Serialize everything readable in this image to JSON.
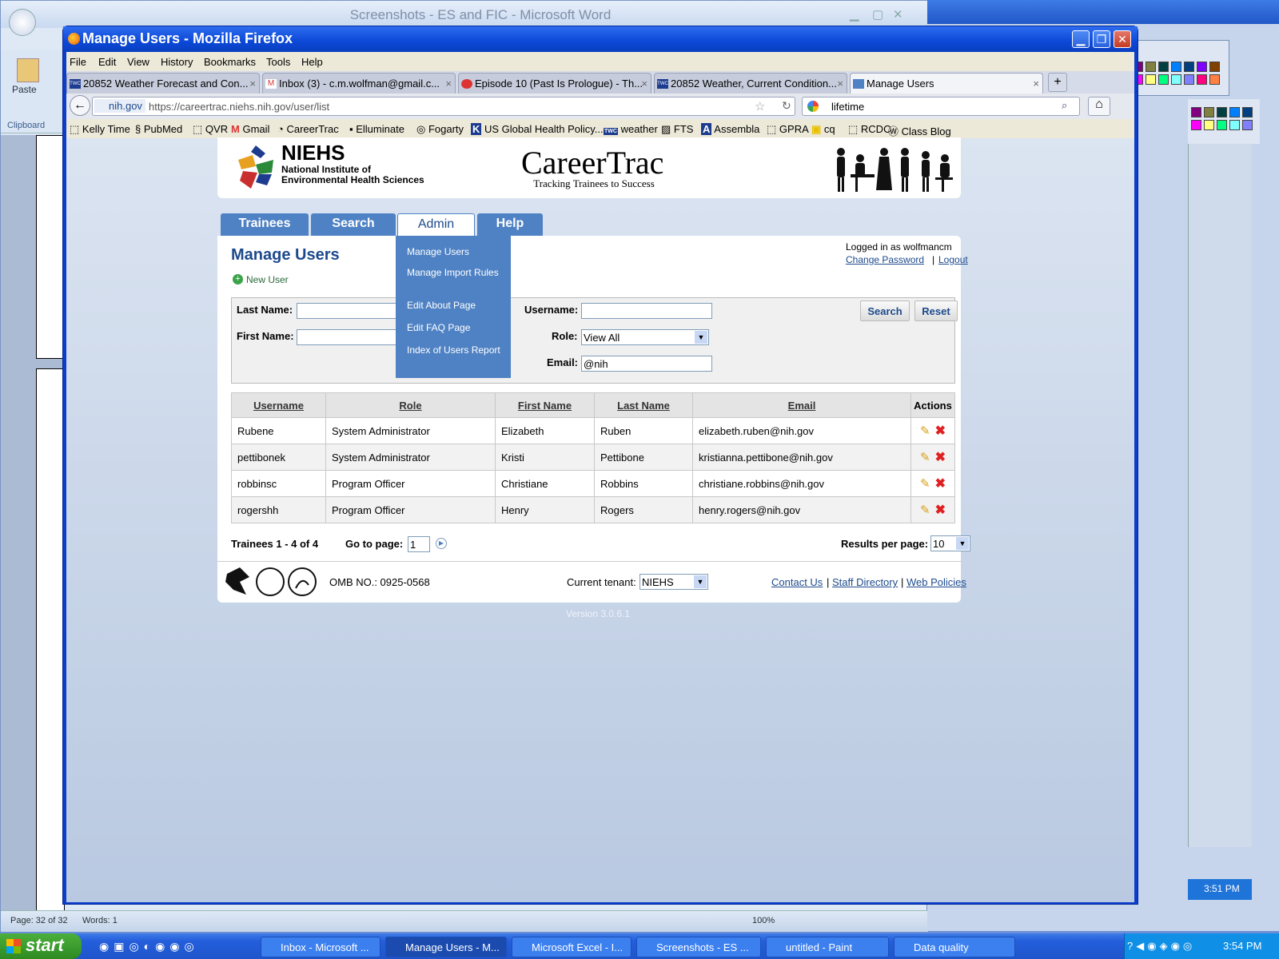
{
  "word": {
    "title": "Screenshots - ES and FIC - Microsoft Word",
    "paste_label": "Paste",
    "clipboard_label": "Clipboard",
    "status_page": "Page: 32 of 32",
    "status_words": "Words: 1",
    "zoom": "100%"
  },
  "firefox": {
    "title": "Manage Users - Mozilla Firefox",
    "menu": [
      "File",
      "Edit",
      "View",
      "History",
      "Bookmarks",
      "Tools",
      "Help"
    ],
    "tabs": [
      "20852 Weather Forecast and Con...",
      "Inbox (3) - c.m.wolfman@gmail.c...",
      "Episode 10 (Past Is Prologue) - Th...",
      "20852 Weather, Current Condition...",
      "Manage Users"
    ],
    "site_id": "nih.gov",
    "url": "https://careertrac.niehs.nih.gov/user/list",
    "search_value": "lifetime",
    "bookmarks": [
      "Kelly Time",
      "PubMed",
      "QVR",
      "Gmail",
      "CareerTrac",
      "Elluminate",
      "Fogarty",
      "US Global Health Policy...",
      "weather",
      "FTS",
      "Assembla",
      "GPRA",
      "cq",
      "RCDC",
      "Class Blog"
    ]
  },
  "header": {
    "niehs": "NIEHS",
    "niehs_sub1": "National Institute of",
    "niehs_sub2": "Environmental Health Sciences",
    "brand": "CareerTrac",
    "tagline": "Tracking Trainees to Success"
  },
  "nav": {
    "tabs": [
      "Trainees",
      "Search",
      "Admin",
      "Help"
    ],
    "admin_menu": [
      "Manage Users",
      "Manage Import Rules",
      "Edit About Page",
      "Edit FAQ Page",
      "Index of Users Report"
    ]
  },
  "page": {
    "title": "Manage Users",
    "new_user": "New User",
    "logged_in": "Logged in as wolfmancm",
    "change_password": "Change Password",
    "logout": "Logout"
  },
  "form": {
    "last_name_label": "Last Name:",
    "first_name_label": "First Name:",
    "username_label": "Username:",
    "role_label": "Role:",
    "role_value": "View All",
    "email_label": "Email:",
    "email_value": "@nih",
    "search_btn": "Search",
    "reset_btn": "Reset"
  },
  "table": {
    "headers": [
      "Username",
      "Role",
      "First Name",
      "Last Name",
      "Email",
      "Actions"
    ],
    "rows": [
      [
        "Rubene",
        "System Administrator",
        "Elizabeth",
        "Ruben",
        "elizabeth.ruben@nih.gov"
      ],
      [
        "pettibonek",
        "System Administrator",
        "Kristi",
        "Pettibone",
        "kristianna.pettibone@nih.gov"
      ],
      [
        "robbinsc",
        "Program Officer",
        "Christiane",
        "Robbins",
        "christiane.robbins@nih.gov"
      ],
      [
        "rogershh",
        "Program Officer",
        "Henry",
        "Rogers",
        "henry.rogers@nih.gov"
      ]
    ]
  },
  "pager": {
    "summary": "Trainees 1 - 4 of 4",
    "goto_label": "Go to page:",
    "goto_value": "1",
    "rpp_label": "Results per page:",
    "rpp_value": "10"
  },
  "footer": {
    "omb": "OMB NO.: 0925-0568",
    "tenant_label": "Current tenant:",
    "tenant_value": "NIEHS",
    "contact": "Contact Us",
    "staff": "Staff Directory",
    "policies": "Web Policies",
    "version": "Version 3.0.6.1"
  },
  "taskbar": {
    "start": "start",
    "buttons": [
      "Inbox - Microsoft ...",
      "Manage Users - M...",
      "Microsoft Excel - I...",
      "Screenshots - ES ...",
      "untitled - Paint",
      "Data quality"
    ],
    "clock": "3:54 PM",
    "clock_behind": "3:51 PM"
  }
}
